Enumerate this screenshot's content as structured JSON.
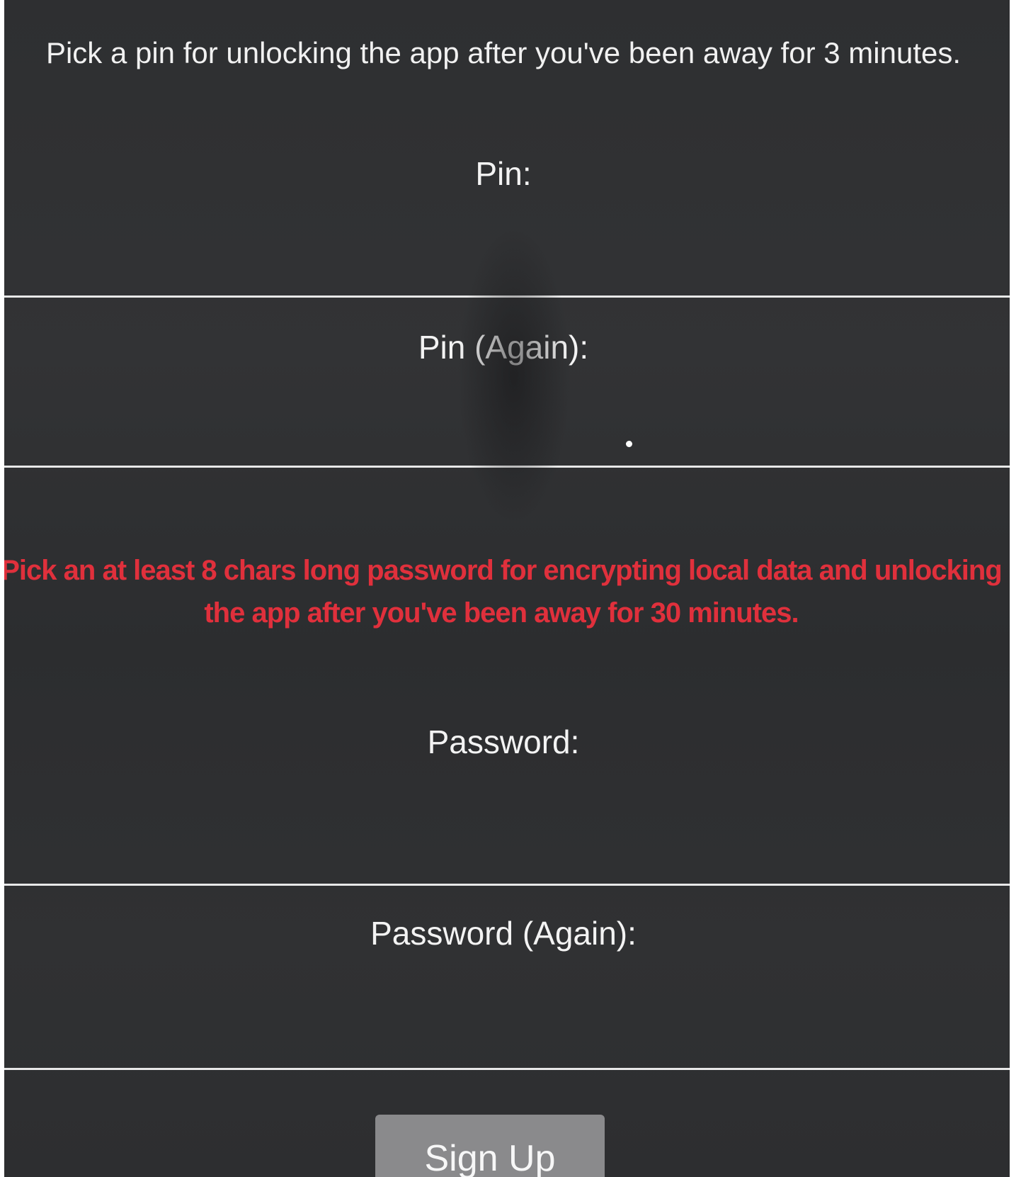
{
  "pin_section": {
    "instructions": "Pick a pin for unlocking the app after you've been away for 3 minutes.",
    "pin_label": "Pin:",
    "pin_again_label": "Pin (Again):"
  },
  "password_section": {
    "instructions": "Pick an at least 8 chars long password for encrypting local data and unlocking the app after you've been away for 30 minutes.",
    "password_label": "Password:",
    "password_again_label": "Password (Again):"
  },
  "signup_button": {
    "label": "Sign Up"
  },
  "colors": {
    "background": "#2f3032",
    "text": "#f1f1f1",
    "warning_text": "#e0303c",
    "button": "#8a8a8c",
    "underline": "#e8e8e8"
  }
}
